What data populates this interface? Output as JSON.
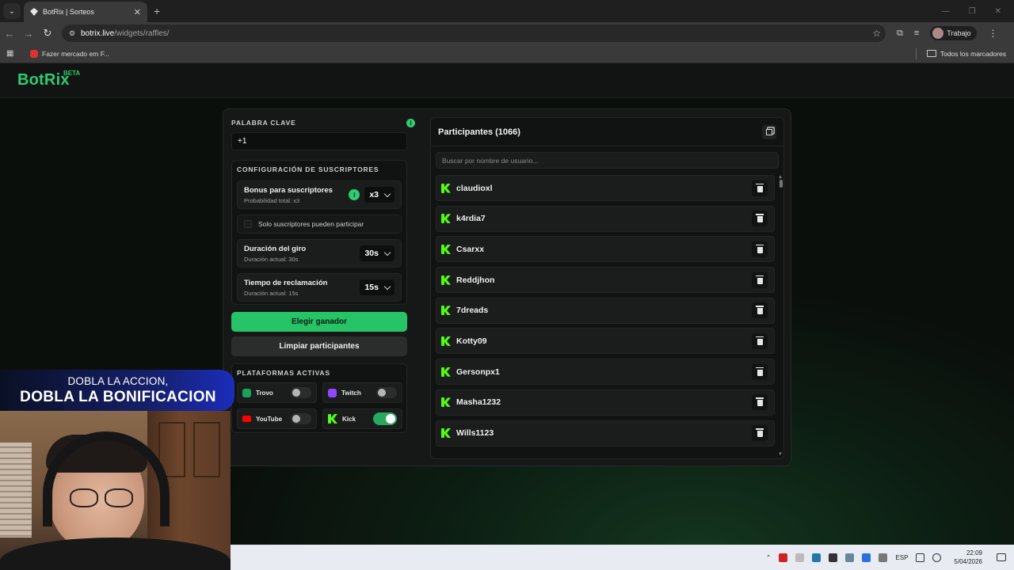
{
  "browser": {
    "tab_title": "BotRix | Sorteos",
    "new_tab": "+",
    "tab_close": "✕",
    "url_host": "botrix.live",
    "url_path": "/widgets/raffles/",
    "profile_label": "Trabajo",
    "bookmark": "Fazer mercado em F...",
    "all_bookmarks": "Todos los marcadores"
  },
  "site": {
    "logo": "BotRix",
    "logo_badge": "BETA"
  },
  "keyword": {
    "label": "PALABRA CLAVE",
    "value": "+1",
    "info": "i"
  },
  "subscribers": {
    "label": "CONFIGURACIÓN DE SUSCRIPTORES",
    "bonus_title": "Bonus para suscriptores",
    "bonus_sub": "Probabilidad total: x3",
    "bonus_value": "x3",
    "only_subs": "Solo suscriptores pueden participar",
    "spin_title": "Duración del giro",
    "spin_sub": "Duración actual: 30s",
    "spin_value": "30s",
    "claim_title": "Tiempo de reclamación",
    "claim_sub": "Duración actual: 15s",
    "claim_value": "15s"
  },
  "actions": {
    "pick_winner": "Elegir ganador",
    "clear": "Limpiar participantes"
  },
  "platforms": {
    "label": "PLATAFORMAS ACTIVAS",
    "items": [
      {
        "name": "Trovo",
        "enabled": false,
        "color": "#1aa15b"
      },
      {
        "name": "Twitch",
        "enabled": false,
        "color": "#9146ff"
      },
      {
        "name": "YouTube",
        "enabled": false,
        "color": "#ff0000"
      },
      {
        "name": "Kick",
        "enabled": true,
        "color": "#53fc18"
      }
    ]
  },
  "participants": {
    "title": "Participantes (1066)",
    "search_placeholder": "Buscar por nombre de usuario...",
    "users": [
      "claudioxl",
      "k4rdia7",
      "Csarxx",
      "Reddjhon",
      "7dreads",
      "Kotty09",
      "Gersonpx1",
      "Masha1232",
      "Wills1123"
    ]
  },
  "overlay": {
    "line1": "DOBLA LA ACCION,",
    "line2": "DOBLA LA BONIFICACION"
  },
  "taskbar": {
    "lang": "ESP",
    "time": "22:09",
    "date": "5/04/2026"
  },
  "colors": {
    "accent": "#26c467",
    "kick": "#53fc18"
  }
}
